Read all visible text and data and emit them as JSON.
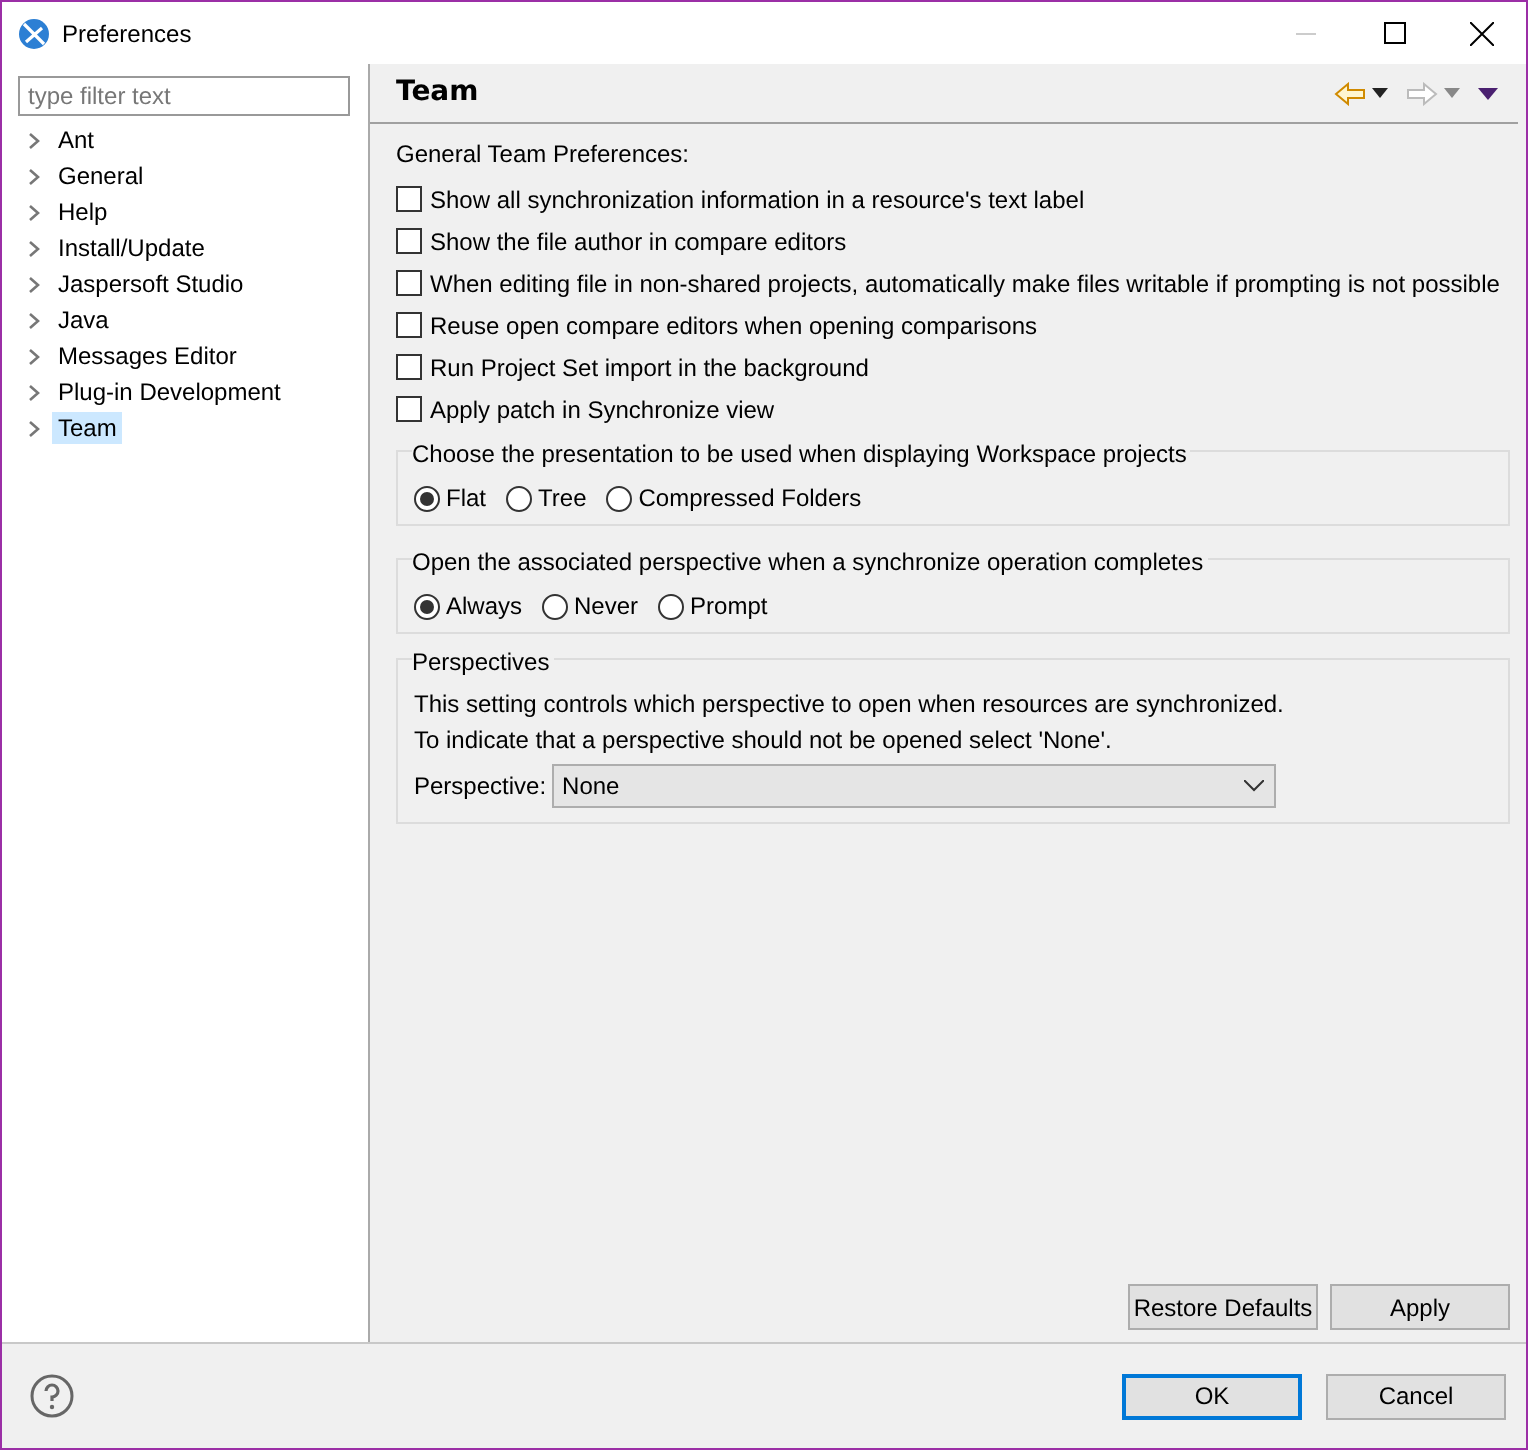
{
  "window": {
    "title": "Preferences"
  },
  "sidebar": {
    "filter": {
      "placeholder": "type filter text"
    },
    "items": [
      {
        "label": "Ant",
        "selected": false
      },
      {
        "label": "General",
        "selected": false
      },
      {
        "label": "Help",
        "selected": false
      },
      {
        "label": "Install/Update",
        "selected": false
      },
      {
        "label": "Jaspersoft Studio",
        "selected": false
      },
      {
        "label": "Java",
        "selected": false
      },
      {
        "label": "Messages Editor",
        "selected": false
      },
      {
        "label": "Plug-in Development",
        "selected": false
      },
      {
        "label": "Team",
        "selected": true
      }
    ]
  },
  "page": {
    "title": "Team",
    "section_label": "General Team Preferences:",
    "checkboxes": [
      {
        "label": "Show all synchronization information in a resource's text label",
        "checked": false
      },
      {
        "label": "Show the file author in compare editors",
        "checked": false
      },
      {
        "label": "When editing file in non-shared projects, automatically make files writable if prompting is not possible",
        "checked": false
      },
      {
        "label": "Reuse open compare editors when opening comparisons",
        "checked": false
      },
      {
        "label": "Run Project Set import in the background",
        "checked": false
      },
      {
        "label": "Apply patch in Synchronize view",
        "checked": false
      }
    ],
    "groups": [
      {
        "title": "Choose the presentation to be used when displaying Workspace projects",
        "options": [
          {
            "label": "Flat",
            "selected": true
          },
          {
            "label": "Tree",
            "selected": false
          },
          {
            "label": "Compressed Folders",
            "selected": false
          }
        ]
      },
      {
        "title": "Open the associated perspective when a synchronize operation completes",
        "options": [
          {
            "label": "Always",
            "selected": true
          },
          {
            "label": "Never",
            "selected": false
          },
          {
            "label": "Prompt",
            "selected": false
          }
        ]
      }
    ],
    "perspectives": {
      "title": "Perspectives",
      "description_lines": [
        "This setting controls which perspective to open when resources are synchronized.",
        "To indicate that a perspective should not be opened select 'None'."
      ],
      "field_label": "Perspective:",
      "value": "None"
    },
    "buttons": [
      "Restore Defaults",
      "Apply"
    ]
  },
  "footer": {
    "buttons": [
      {
        "label": "OK",
        "default": true
      },
      {
        "label": "Cancel",
        "default": false
      }
    ]
  }
}
